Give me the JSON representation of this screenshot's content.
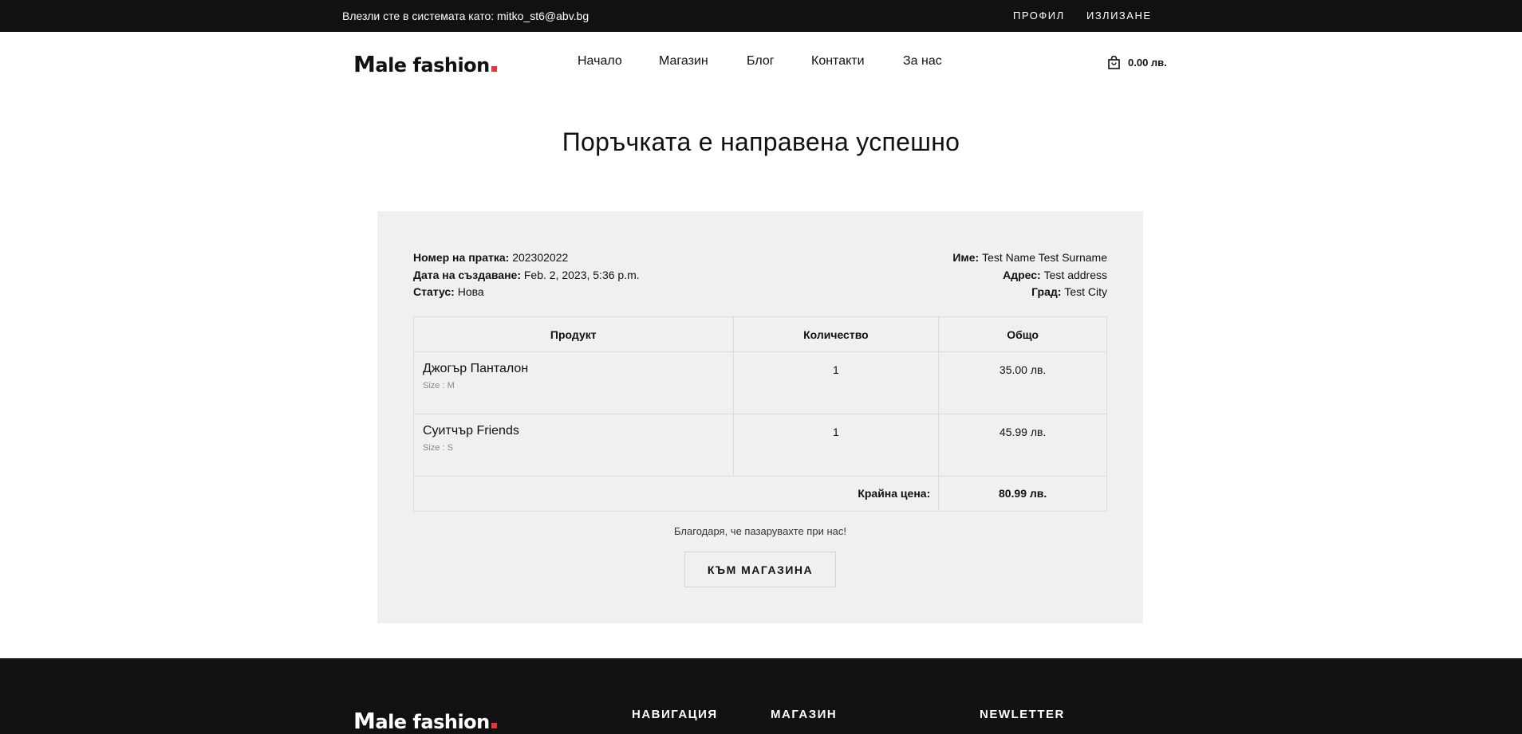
{
  "topbar": {
    "login_text": "Влезли сте в системата като: mitko_st6@abv.bg",
    "profile_link": "ПРОФИЛ",
    "logout_link": "ИЗЛИЗАНЕ"
  },
  "header": {
    "logo_first": "M",
    "logo_rest": "ale fashion",
    "nav": [
      "Начало",
      "Магазин",
      "Блог",
      "Контакти",
      "За нас"
    ],
    "cart_total": "0.00 лв.",
    "cart_icon": "shopping-bag-icon"
  },
  "page_title": "Поръчката е направена успешно",
  "order": {
    "number_label": "Номер на пратка:",
    "number_value": "202302022",
    "date_label": "Дата на създаване:",
    "date_value": "Feb. 2, 2023, 5:36 p.m.",
    "status_label": "Статус:",
    "status_value": "Нова",
    "name_label": "Име:",
    "name_value": "Test Name Test Surname",
    "address_label": "Адрес:",
    "address_value": "Test address",
    "city_label": "Град:",
    "city_value": "Test City",
    "columns": [
      "Продукт",
      "Количество",
      "Общо"
    ],
    "items": [
      {
        "name": "Джогър Панталон",
        "size": "Size : M",
        "quantity": "1",
        "total": "35.00 лв."
      },
      {
        "name": "Суитчър Friends",
        "size": "Size : S",
        "quantity": "1",
        "total": "45.99 лв."
      }
    ],
    "final_label": "Крайна цена:",
    "final_value": "80.99 лв."
  },
  "thanks_text": "Благодаря, че пазарувахте при нас!",
  "shop_button": "КЪМ МАГАЗИНА",
  "footer": {
    "logo_first": "M",
    "logo_rest": "ale fashion",
    "headings": [
      "НАВИГАЦИЯ",
      "МАГАЗИН",
      "NEWLETTER"
    ]
  },
  "colors": {
    "topbar_bg": "#111111",
    "accent": "#e53637",
    "panel_bg": "#f0f0f0"
  }
}
